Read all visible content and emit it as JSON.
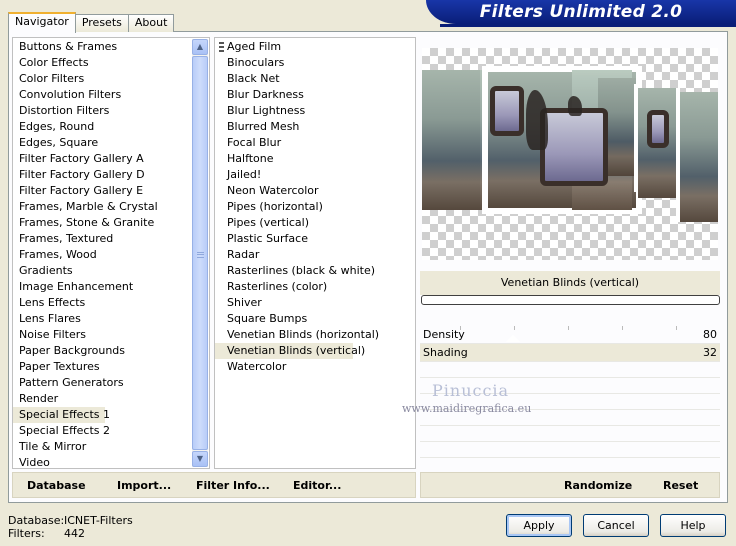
{
  "banner": {
    "title": "Filters Unlimited 2.0"
  },
  "tabs": [
    {
      "label": "Navigator",
      "active": true
    },
    {
      "label": "Presets",
      "active": false
    },
    {
      "label": "About",
      "active": false
    }
  ],
  "categories": {
    "selected": "Special Effects 1",
    "items": [
      "Buttons & Frames",
      "Color Effects",
      "Color Filters",
      "Convolution Filters",
      "Distortion Filters",
      "Edges, Round",
      "Edges, Square",
      "Filter Factory Gallery A",
      "Filter Factory Gallery D",
      "Filter Factory Gallery E",
      "Frames, Marble & Crystal",
      "Frames, Stone & Granite",
      "Frames, Textured",
      "Frames, Wood",
      "Gradients",
      "Image Enhancement",
      "Lens Effects",
      "Lens Flares",
      "Noise Filters",
      "Paper Backgrounds",
      "Paper Textures",
      "Pattern Generators",
      "Render",
      "Special Effects 1",
      "Special Effects 2",
      "Tile & Mirror",
      "Video"
    ]
  },
  "filters": {
    "selected": "Venetian Blinds (vertical)",
    "items": [
      "Aged Film",
      "Binoculars",
      "Black Net",
      "Blur Darkness",
      "Blur Lightness",
      "Blurred Mesh",
      "Focal Blur",
      "Halftone",
      "Jailed!",
      "Neon Watercolor",
      "Pipes (horizontal)",
      "Pipes (vertical)",
      "Plastic Surface",
      "Radar",
      "Rasterlines (black & white)",
      "Rasterlines (color)",
      "Shiver",
      "Square Bumps",
      "Venetian Blinds (horizontal)",
      "Venetian Blinds (vertical)",
      "Watercolor"
    ]
  },
  "preview": {
    "filter_name": "Venetian Blinds (vertical)",
    "progress": 0
  },
  "params": [
    {
      "label": "Density",
      "value": "80"
    },
    {
      "label": "Shading",
      "value": "32"
    }
  ],
  "watermark": {
    "name": "Pinuccia",
    "url": "www.maidiregrafica.eu"
  },
  "left_bar": {
    "database": "Database",
    "import": "Import...",
    "filter_info": "Filter Info...",
    "editor": "Editor..."
  },
  "right_bar": {
    "randomize": "Randomize",
    "reset": "Reset"
  },
  "footer": {
    "database_label": "Database:",
    "database_value": "ICNET-Filters",
    "filters_label": "Filters:",
    "filters_value": "442"
  },
  "dialog_buttons": {
    "apply": "Apply",
    "cancel": "Cancel",
    "help": "Help"
  },
  "colors": {
    "banner": "#0a1e78",
    "selection": "#ece9d8",
    "panel": "#ece9d8"
  },
  "icons": {
    "scroll_up": "chevron-up-icon",
    "scroll_down": "chevron-down-icon"
  }
}
